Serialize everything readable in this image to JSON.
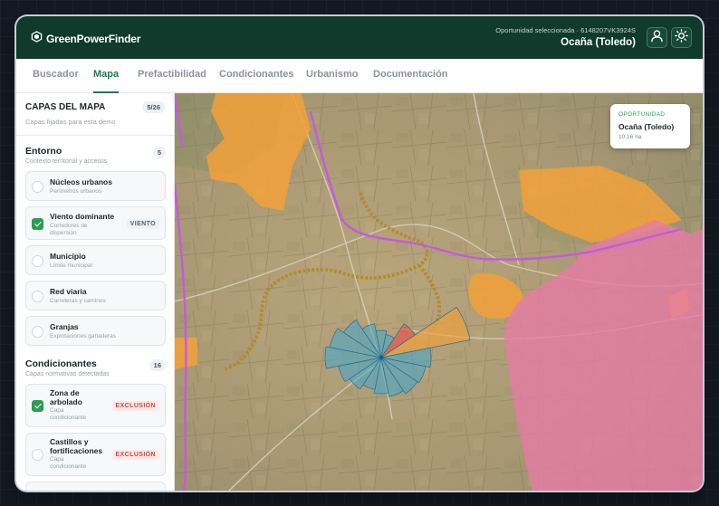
{
  "header": {
    "brand": "GreenPowerFinder",
    "opportunity_label": "Oportunidad seleccionada · 6148207VK3924S",
    "opportunity_place": "Ocaña (Toledo)",
    "user_icon": "user-icon",
    "theme_icon": "sun-icon"
  },
  "nav": {
    "tabs": [
      {
        "label": "Buscador"
      },
      {
        "label": "Mapa"
      },
      {
        "label": "Prefactibilidad"
      },
      {
        "label": "Condicionantes"
      },
      {
        "label": "Urbanismo"
      },
      {
        "label": "Documentación"
      }
    ],
    "active": "Mapa"
  },
  "sidebar": {
    "title": "CAPAS DEL MAPA",
    "count": "5/26",
    "subtitle": "Capas fijadas para esta demo",
    "entorno": {
      "title": "Entorno",
      "subtitle": "Contexto territorial y accesos",
      "count": "5",
      "layers": [
        {
          "name": "Núcleos urbanos",
          "desc": "Perímetros urbanos",
          "checked": false
        },
        {
          "name": "Viento dominante",
          "desc": "Corredores de dispersión",
          "checked": true,
          "tag": "VIENTO"
        },
        {
          "name": "Municipio",
          "desc": "Límite municipal",
          "checked": false
        },
        {
          "name": "Red viaria",
          "desc": "Carreteras y caminos",
          "checked": false
        },
        {
          "name": "Granjas",
          "desc": "Explotaciones ganaderas",
          "checked": false
        }
      ]
    },
    "condicionantes": {
      "title": "Condicionantes",
      "subtitle": "Capas normativas detectadas",
      "count": "16",
      "layers": [
        {
          "name": "Zona de arbolado",
          "desc": "Capa condicionante",
          "checked": true,
          "tag": "EXCLUSIÓN"
        },
        {
          "name": "Castillos y fortificaciones",
          "desc": "Capa condicionante",
          "checked": false,
          "tag": "EXCLUSIÓN"
        }
      ]
    }
  },
  "map": {
    "card": {
      "label": "OPORTUNIDAD",
      "name": "Ocaña (Toledo)",
      "area": "10,16 ha"
    }
  },
  "colors": {
    "header_bg": "#0f3a2c",
    "accent": "#1e7a4c",
    "urban_orange": "#f2a13a",
    "exclusion_pink": "#e57ba3",
    "boundary_purple": "#c45adf",
    "wind_blue": "#4aa6c9",
    "wind_red": "#e2564f"
  }
}
